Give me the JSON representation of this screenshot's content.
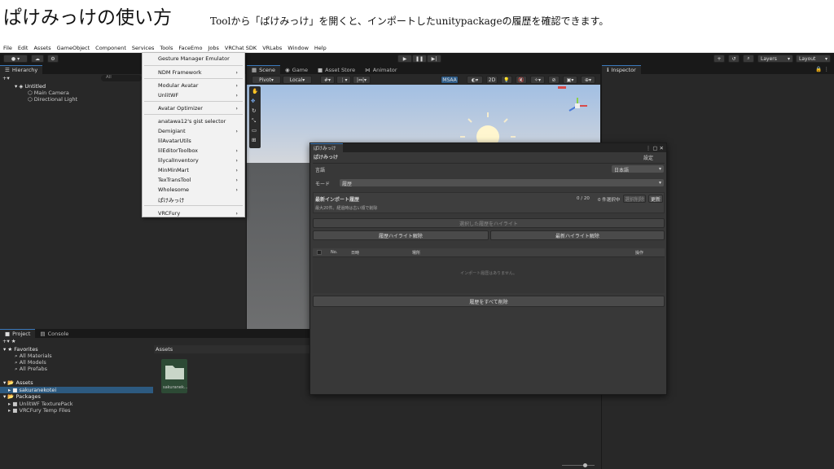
{
  "header": {
    "title": "ぱけみっけの使い方",
    "subtitle": "Toolから「ぱけみっけ」を開くと、インポートしたunitypackageの履歴を確認できます。"
  },
  "menubar": {
    "items": [
      "File",
      "Edit",
      "Assets",
      "GameObject",
      "Component",
      "Services",
      "Tools",
      "FaceEmo",
      "Jobs",
      "VRChat SDK",
      "VRLabs",
      "Window",
      "Help"
    ]
  },
  "toolbar": {
    "layers": "Layers",
    "layout": "Layout"
  },
  "hierarchy": {
    "tab": "Hierarchy",
    "search": "All",
    "scene": "Untitled",
    "objects": [
      "Main Camera",
      "Directional Light"
    ]
  },
  "scene": {
    "tabs": [
      "Scene",
      "Game",
      "Asset Store",
      "Animator"
    ],
    "pivot": "Pivot",
    "local": "Local",
    "msaa": "MSAA",
    "mode2d": "2D"
  },
  "inspector": {
    "tab": "Inspector"
  },
  "tools_menu": {
    "items": [
      {
        "label": "Gesture Manager Emulator",
        "arrow": ""
      },
      {
        "label": "NDM Framework",
        "arrow": "›"
      },
      {
        "label": "Modular Avatar",
        "arrow": "›"
      },
      {
        "label": "UnlitWF",
        "arrow": "›"
      },
      {
        "label": "Avatar Optimizer",
        "arrow": "›"
      },
      {
        "label": "anatawa12's gist selector",
        "arrow": ""
      },
      {
        "label": "Demigiant",
        "arrow": "›"
      },
      {
        "label": "lilAvatarUtils",
        "arrow": ""
      },
      {
        "label": "lilEditorToolbox",
        "arrow": "›"
      },
      {
        "label": "lilycalInventory",
        "arrow": "›"
      },
      {
        "label": "MinMinMart",
        "arrow": "›"
      },
      {
        "label": "TexTransTool",
        "arrow": "›"
      },
      {
        "label": "Wholesome",
        "arrow": "›"
      },
      {
        "label": "ぱけみっけ",
        "arrow": ""
      },
      {
        "label": "VRCFury",
        "arrow": "›"
      }
    ]
  },
  "window": {
    "tab": "ぱけみっけ",
    "title": "ぱけみっけ",
    "settings": "設定",
    "lang_label": "言語",
    "lang_value": "日本語",
    "mode_label": "モード",
    "mode_value": "履歴",
    "recent_title": "最新インポート履歴",
    "recent_note": "最大20件。経過時は古い順で削除",
    "count": "0 / 20",
    "selected": "0 件選択中",
    "delete_selected": "選択削除",
    "refresh": "更新",
    "highlight_selected": "選択した履歴をハイライト",
    "clear_history_highlight": "履歴ハイライト解除",
    "clear_recent_highlight": "最新ハイライト解除",
    "col_no": "No.",
    "col_date": "日時",
    "col_place": "場所",
    "col_action": "操作",
    "empty": "インポート履歴はありません。",
    "delete_all": "履歴をすべて削除"
  },
  "project": {
    "tabs": [
      "Project",
      "Console"
    ],
    "favorites": "Favorites",
    "fav_items": [
      "All Materials",
      "All Models",
      "All Prefabs"
    ],
    "assets": "Assets",
    "asset_folder": "sakuranekotei",
    "packages": "Packages",
    "package_items": [
      "UnlitWF TexturePack",
      "VRCFury Temp Files"
    ],
    "assets_header": "Assets",
    "folder_label": "sakuranek..."
  }
}
